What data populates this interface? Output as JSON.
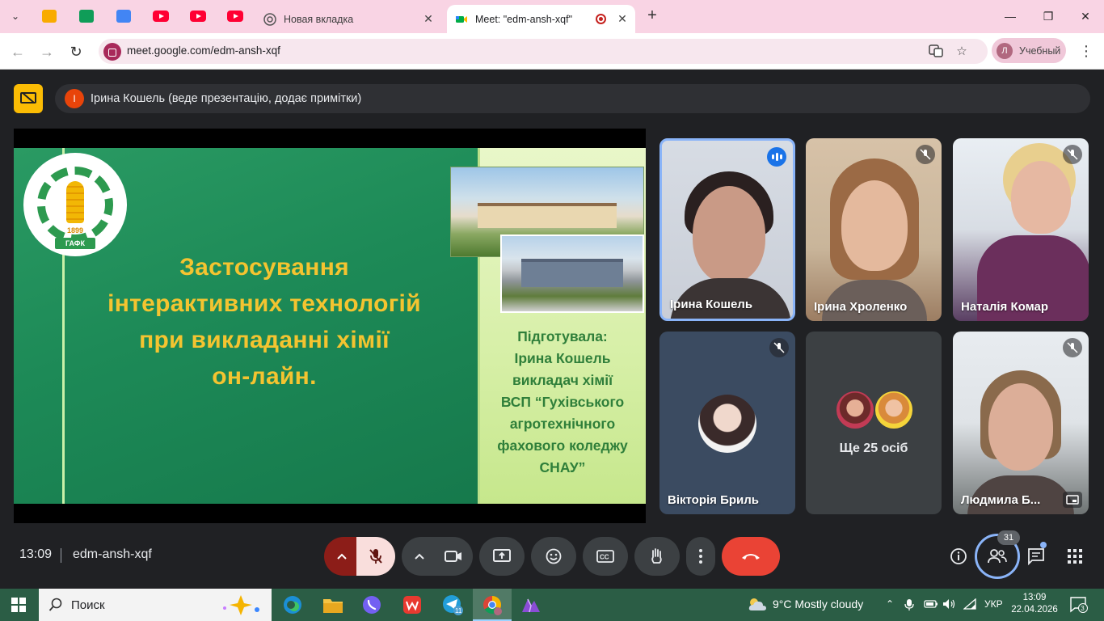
{
  "browser": {
    "tabs": [
      {
        "label": "Новая вкладка"
      },
      {
        "label": "Meet: \"edm-ansh-xqf\""
      }
    ],
    "url": "meet.google.com/edm-ansh-xqf",
    "profile_initial": "Л",
    "profile_name": "Учебный"
  },
  "meet": {
    "presenter_initial": "І",
    "presenter_banner": "Ірина Кошель (веде презентацію, додає примітки)",
    "slide": {
      "title_lines": [
        "Застосування",
        "інтерактивних технологій",
        "при викладанні хімії",
        "он-лайн."
      ],
      "logo_year": "1899",
      "logo_abbr": "ГАФК",
      "author_lines": [
        "Підготувала:",
        "Ірина Кошель",
        "викладач хімії",
        "ВСП “Гухівського",
        "агротехнічного",
        "фахового коледжу",
        "СНАУ”"
      ]
    },
    "participants": [
      {
        "name": "Ірина Кошель",
        "state": "speaking"
      },
      {
        "name": "Ірина Хроленко",
        "state": "muted"
      },
      {
        "name": "Наталія Комар",
        "state": "muted"
      },
      {
        "name": "Вікторія Бриль",
        "state": "muted"
      },
      {
        "name": "Людмила Б...",
        "state": "muted"
      }
    ],
    "more_participants": "Ще 25 осіб",
    "time": "13:09",
    "meeting_code": "edm-ansh-xqf",
    "participant_count": "31"
  },
  "taskbar": {
    "search_placeholder": "Поиск",
    "weather": "9°C  Mostly cloudy",
    "language": "УКР",
    "time": "13:09",
    "date": "22.04.2026",
    "notification_count": "3",
    "telegram_badge": "11"
  },
  "colors": {
    "meet_bg": "#202124",
    "end_call": "#ea4335",
    "tabbar": "#f9d4e4",
    "taskbar": "#2b5d45",
    "slide_green": "#1f8a5a",
    "slide_title": "#f4c430"
  }
}
